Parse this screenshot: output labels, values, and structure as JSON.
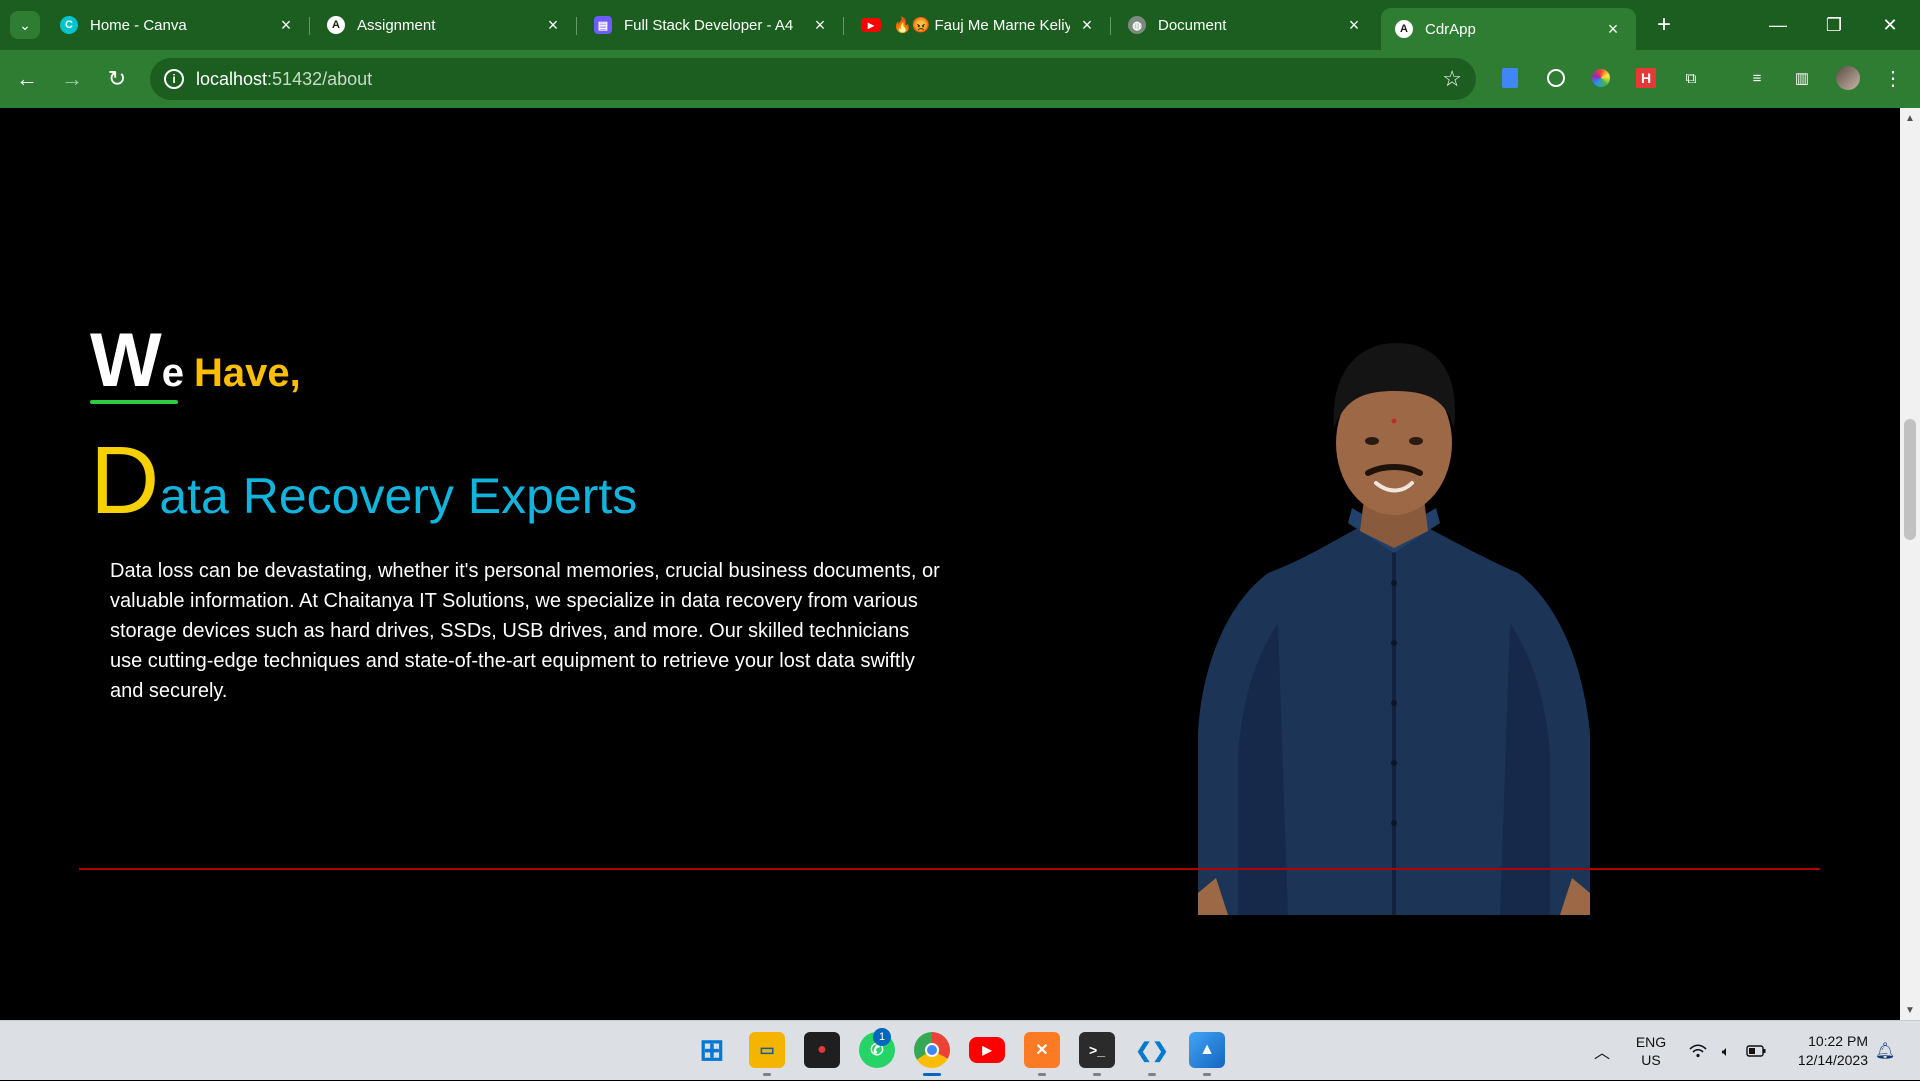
{
  "browser": {
    "tabs": [
      {
        "title": "Home - Canva",
        "icon": "canva-icon",
        "icon_glyph": "C",
        "icon_color": "#00c4cc"
      },
      {
        "title": "Assignment",
        "icon": "angular-icon",
        "icon_glyph": "A",
        "icon_color": "#1a1a1a"
      },
      {
        "title": "Full Stack Developer - A4",
        "icon": "canva-doc-icon",
        "icon_glyph": "▤",
        "icon_color": "#6f5bff"
      },
      {
        "title": "🔥😡 Fauj Me Marne Keliy",
        "icon": "youtube-icon",
        "icon_glyph": "▶",
        "icon_color": "#ff0000"
      },
      {
        "title": "Document",
        "icon": "globe-icon",
        "icon_glyph": "◍",
        "icon_color": "#7d8b7e"
      },
      {
        "title": "CdrApp",
        "icon": "angular-icon",
        "icon_glyph": "A",
        "icon_color": "#1a1a1a"
      }
    ],
    "active_tab": 5,
    "address": {
      "host": "localhost",
      "rest": ":51432/about"
    },
    "new_tab_glyph": "+",
    "window_controls": {
      "minimize": "—",
      "restore": "❐",
      "close": "✕"
    }
  },
  "page": {
    "heading1": {
      "big": "W",
      "small": "e",
      "accent": "Have,"
    },
    "heading2": {
      "big": "D",
      "rest": "ata Recovery Experts"
    },
    "paragraph": "Data loss can be devastating, whether it's personal memories, crucial business documents, or valuable information. At Chaitanya IT Solutions, we specialize in data recovery from various storage devices such as hard drives, SSDs, USB drives, and more. Our skilled technicians use cutting-edge techniques and state-of-the-art equipment to retrieve your lost data swiftly and securely."
  },
  "colors": {
    "chrome_dark": "#1b5e20",
    "chrome_light": "#2e7d32",
    "accent_yellow": "#fbbf00",
    "accent_cyan": "#11b4dc",
    "underline_green": "#2ecc40",
    "divider_red": "#b00000"
  },
  "taskbar": {
    "apps": [
      {
        "name": "start-icon",
        "glyph": "⊞",
        "color": "#0078d4",
        "active": false
      },
      {
        "name": "file-explorer-icon",
        "glyph": "▭",
        "color": "#f4b400",
        "active": true
      },
      {
        "name": "screen-recorder-icon",
        "glyph": "●",
        "color": "#d32f2f",
        "active": false
      },
      {
        "name": "whatsapp-icon",
        "glyph": "✆",
        "color": "#25d366",
        "active": false
      },
      {
        "name": "chrome-icon",
        "glyph": "◉",
        "color": "#34a853",
        "active": true
      },
      {
        "name": "youtube-icon",
        "glyph": "▶",
        "color": "#ff0000",
        "active": false
      },
      {
        "name": "xampp-icon",
        "glyph": "✕",
        "color": "#fb7a24",
        "active": true
      },
      {
        "name": "terminal-icon",
        "glyph": ">_",
        "color": "#2b2b2b",
        "active": true
      },
      {
        "name": "vscode-icon",
        "glyph": "❮❯",
        "color": "#007acc",
        "active": true
      },
      {
        "name": "photos-icon",
        "glyph": "▲",
        "color": "#1e88e5",
        "active": true
      }
    ],
    "whatsapp_badge": "1",
    "language": {
      "line1": "ENG",
      "line2": "US"
    },
    "time": "10:22 PM",
    "date": "12/14/2023"
  }
}
